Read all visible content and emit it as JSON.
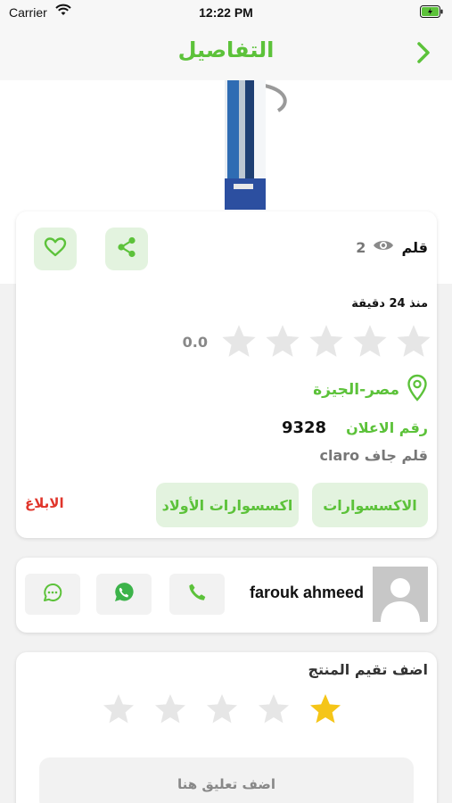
{
  "status_bar": {
    "carrier": "Carrier",
    "time": "12:22 PM"
  },
  "nav": {
    "title": "التفاصيل",
    "back_icon": "chevron-right-icon"
  },
  "product": {
    "title": "قلم",
    "views": "2",
    "time_ago": "منذ 24 دقيقة",
    "rating": {
      "value": "0.0",
      "stars": 0,
      "max": 5
    },
    "location": "مصر-الجيزة",
    "ad_number_label": "رقم الاعلان",
    "ad_number": "9328",
    "description": "قلم جاف claro",
    "tags": [
      "الاكسسوارات",
      "اكسسوارات الأولاد"
    ],
    "report_label": "الابلاغ"
  },
  "seller": {
    "name": "farouk ahmeed"
  },
  "rate_section": {
    "title": "اضف تقيم المنتج",
    "selected_stars": 1,
    "max_stars": 5,
    "comment_placeholder": "اضف تعليق هنا"
  },
  "colors": {
    "accent": "#5cc23a",
    "accent_light": "#e3f3df",
    "star_active": "#f5c518",
    "star_inactive": "#e6e6e6",
    "report": "#e0352b",
    "whatsapp": "#3cb34a"
  }
}
